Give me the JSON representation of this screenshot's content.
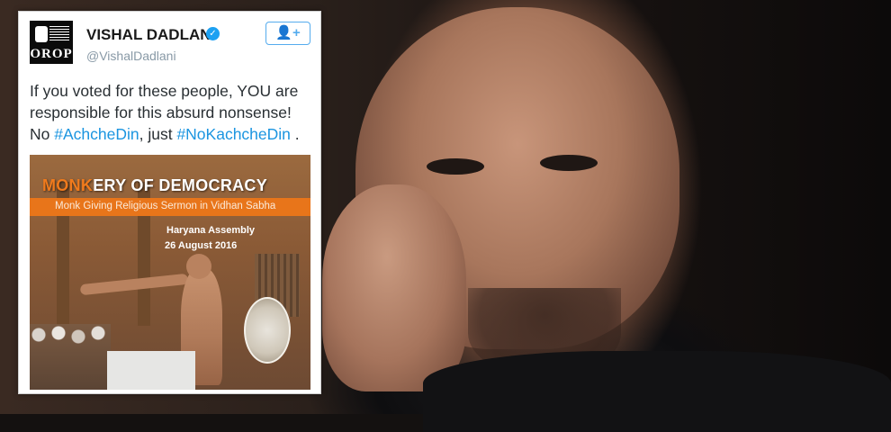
{
  "tweet": {
    "display_name": "VISHAL DADLANI",
    "handle": "@VishalDadlani",
    "verified_icon": "check-badge-icon",
    "follow_icon": "add-user-icon",
    "avatar_logo_text": "OROP",
    "text_part1": "If you voted for these people, YOU are responsible for this absurd nonsense! No ",
    "hashtag1": "#AchcheDin",
    "text_part2": ", just ",
    "hashtag2": "#NoKachcheDin",
    "text_part3": " .",
    "link_color": "#1b95e0"
  },
  "embedded_image": {
    "title_prefix": "MONK",
    "title_rest": "ERY OF DEMOCRACY",
    "subtitle": "Monk Giving Religious Sermon in Vidhan Sabha",
    "assembly": "Haryana Assembly",
    "date": "26 August 2016",
    "accent_color": "#e8751a"
  }
}
